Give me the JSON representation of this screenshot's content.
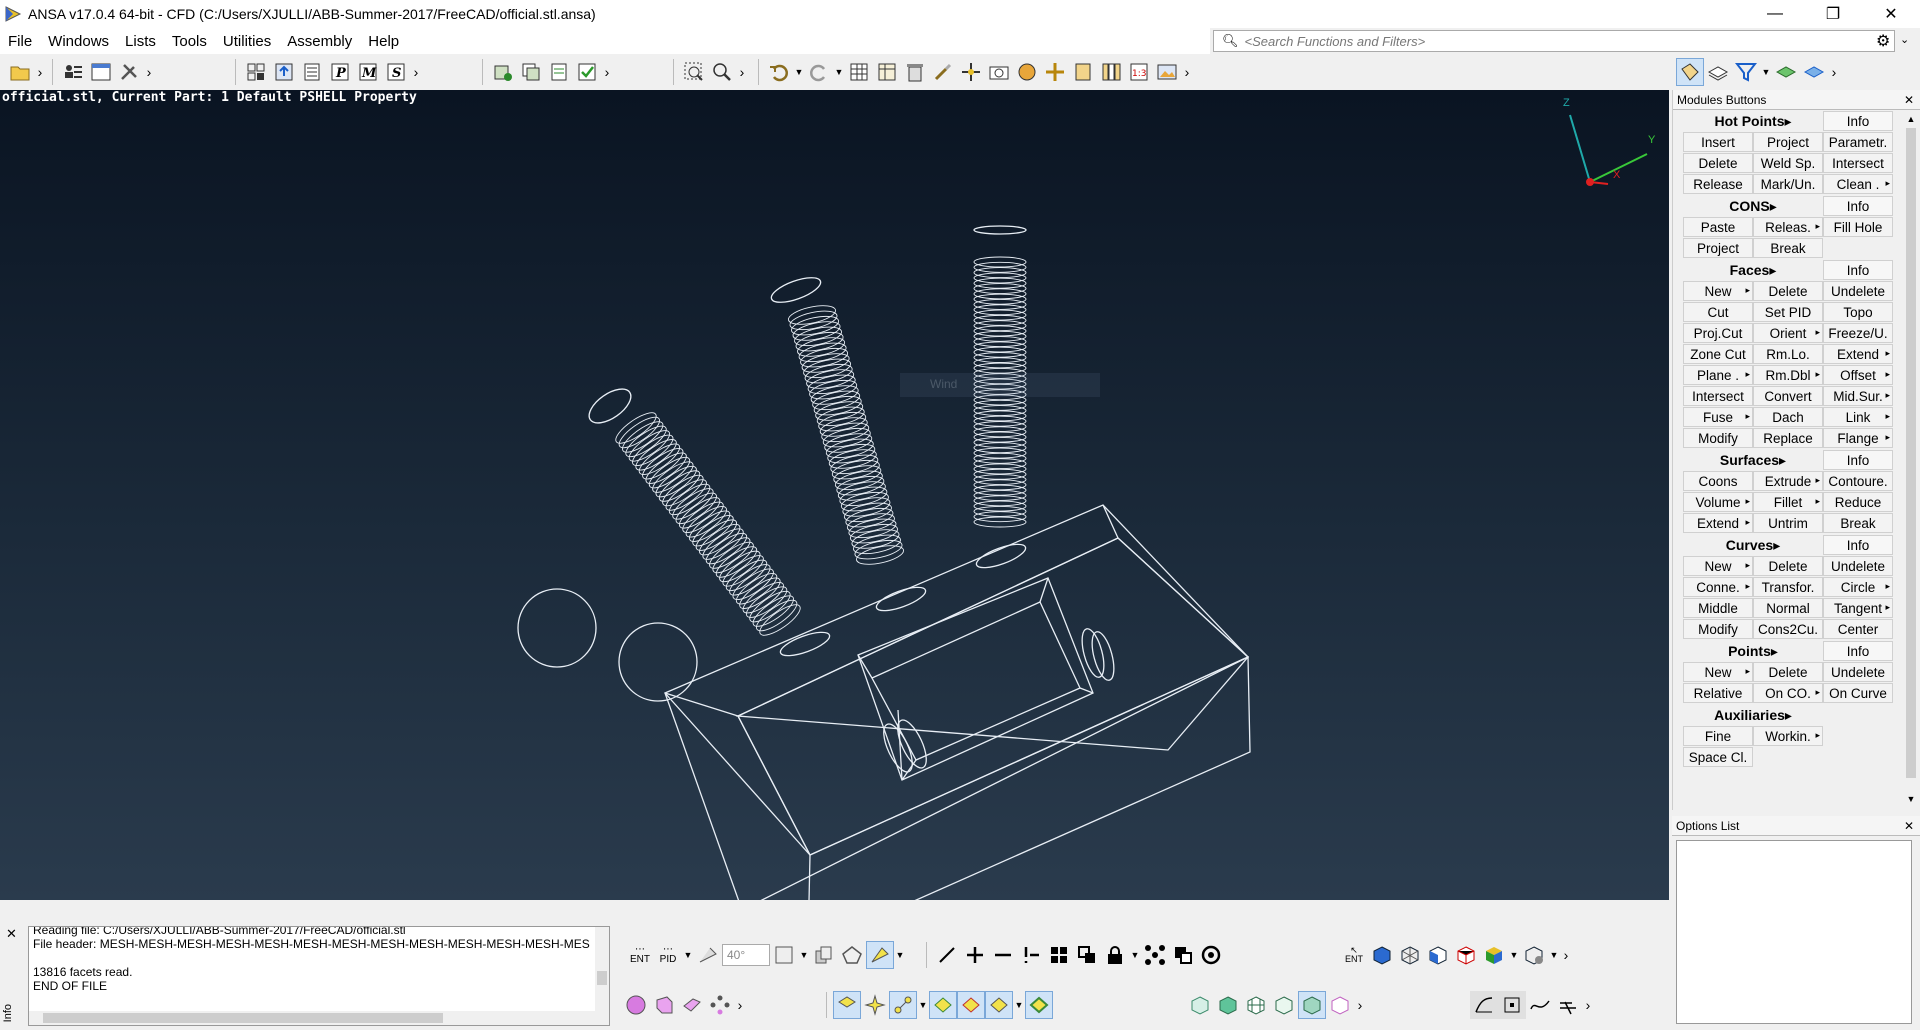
{
  "window": {
    "title": "ANSA v17.0.4 64-bit - CFD (C:/Users/XJULLI/ABB-Summer-2017/FreeCAD/official.stl.ansa)",
    "minimize": "—",
    "restore": "❐",
    "close": "✕"
  },
  "menu": [
    "File",
    "Windows",
    "Lists",
    "Tools",
    "Utilities",
    "Assembly",
    "Help"
  ],
  "search": {
    "placeholder": "<Search Functions and Filters>"
  },
  "viewport": {
    "header": "official.stl,  Current Part: 1 Default PSHELL Property",
    "axis_z": "Z",
    "axis_y": "Y",
    "axis_x": "X",
    "ghost_label": "Wind"
  },
  "modules_panel": {
    "title": "Modules Buttons",
    "close": "✕",
    "groups": [
      {
        "title": "Hot Points",
        "info": "Info",
        "rows": [
          [
            "Insert",
            "Project",
            "Parametr."
          ],
          [
            "Delete",
            "Weld Sp.",
            "Intersect"
          ],
          [
            "Release",
            "Mark/Un.",
            "Clean ."
          ]
        ]
      },
      {
        "title": "CONS",
        "info": "Info",
        "rows": [
          [
            "Paste",
            "Releas.",
            "Fill Hole"
          ],
          [
            "Project",
            "Break",
            ""
          ]
        ]
      },
      {
        "title": "Faces",
        "info": "Info",
        "rows": [
          [
            "New",
            "Delete",
            "Undelete"
          ],
          [
            "Cut",
            "Set PID",
            "Topo"
          ],
          [
            "Proj.Cut",
            "Orient",
            "Freeze/U."
          ],
          [
            "Zone Cut",
            "Rm.Lo.",
            "Extend"
          ],
          [
            "Plane .",
            "Rm.Dbl",
            "Offset"
          ],
          [
            "Intersect",
            "Convert",
            "Mid.Sur."
          ],
          [
            "Fuse",
            "Dach",
            "Link"
          ],
          [
            "Modify",
            "Replace",
            "Flange"
          ]
        ]
      },
      {
        "title": "Surfaces",
        "info": "Info",
        "rows": [
          [
            "Coons",
            "Extrude",
            "Contoure."
          ],
          [
            "Volume",
            "Fillet",
            "Reduce"
          ],
          [
            "Extend",
            "Untrim",
            "Break"
          ]
        ]
      },
      {
        "title": "Curves",
        "info": "Info",
        "rows": [
          [
            "New",
            "Delete",
            "Undelete"
          ],
          [
            "Conne.",
            "Transfor.",
            "Circle"
          ],
          [
            "Middle",
            "Normal",
            "Tangent"
          ],
          [
            "Modify",
            "Cons2Cu.",
            "Center"
          ]
        ]
      },
      {
        "title": "Points",
        "info": "Info",
        "rows": [
          [
            "New",
            "Delete",
            "Undelete"
          ],
          [
            "Relative",
            "On CO.",
            "On Curve"
          ]
        ]
      },
      {
        "title": "Auxiliaries",
        "info": "",
        "rows": [
          [
            "Fine",
            "Workin.",
            ""
          ],
          [
            "Space Cl.",
            "",
            ""
          ]
        ]
      }
    ]
  },
  "options_panel": {
    "title": "Options List",
    "close": "✕"
  },
  "log": {
    "lines": [
      "Reading file: C:/Users/XJULLI/ABB-Summer-2017/FreeCAD/official.stl",
      "File header: MESH-MESH-MESH-MESH-MESH-MESH-MESH-MESH-MESH-MESH-MESH-MESH-MES",
      "",
      "13816 facets read.",
      "END OF FILE"
    ],
    "close": "✕",
    "side_label": "Info"
  },
  "bottom_toolbar": {
    "ent_label": "ENT",
    "pid_label": "PID",
    "angle_value": "40°",
    "ent_label2": "ENT"
  },
  "colors": {
    "viewport_top": "#0a1422",
    "viewport_bottom": "#2a3b4d",
    "axis_z": "#1fa9a9",
    "axis_y": "#39c839",
    "axis_x": "#e02020"
  }
}
